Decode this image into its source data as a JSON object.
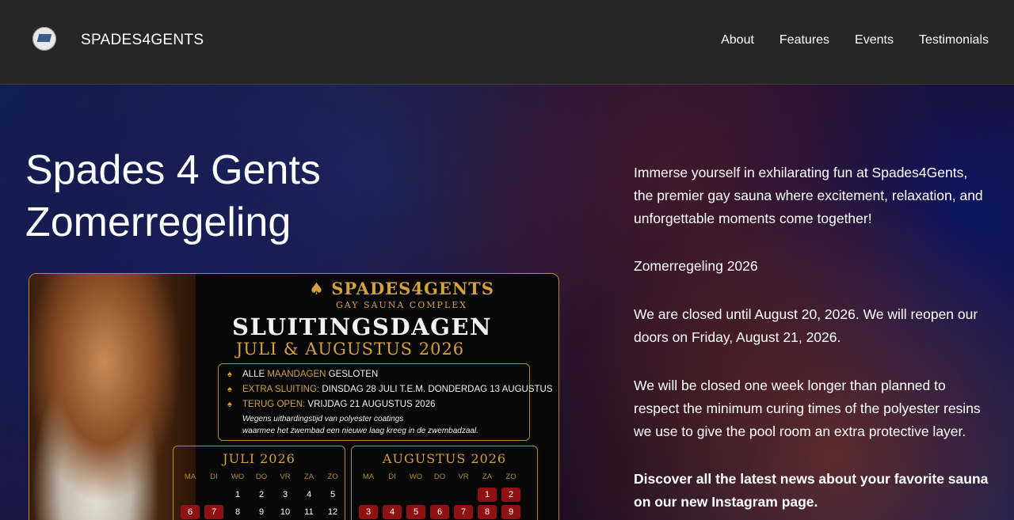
{
  "nav": {
    "brand": "SPADES4GENTS",
    "links": [
      "About",
      "Features",
      "Events",
      "Testimonials"
    ]
  },
  "hero": {
    "title_line1": "Spades 4 Gents",
    "title_line2": "Zomerregeling",
    "paragraphs": [
      "Immerse yourself in exhilarating fun at Spades4Gents, the premier gay sauna where excitement, relaxation, and unforgettable moments come together!",
      "Zomerregeling 2026",
      "We are closed until August 20, 2026. We will reopen our doors on Friday, August 21, 2026.",
      "We will be closed one week longer than planned to respect the minimum curing times of the polyester resins we use to give the pool room an extra protective layer.",
      "Discover all the latest news about your favorite sauna on our new Instagram page."
    ]
  },
  "poster": {
    "brand": "SPADES4GENTS",
    "brand_sub": "GAY SAUNA COMPLEX",
    "heading": "SLUITINGSDAGEN",
    "subheading": "JULI & AUGUSTUS 2026",
    "info": {
      "line1_a": "ALLE ",
      "line1_gold": "MAANDAGEN",
      "line1_b": " GESLOTEN",
      "line2_gold": "EXTRA SLUITING:",
      "line2_b": " DINSDAG 28 JULI T.E.M. DONDERDAG 13 AUGUSTUS",
      "line3_gold": "TERUG OPEN:",
      "line3_b": " VRIJDAG 21 AUGUSTUS 2026",
      "note1": "Wegens uithardingstijd van polyester coatings",
      "note2": "waarmee het zwembad een nieuwe laag kreeg in de zwembadzaal."
    },
    "calendar_july": {
      "title": "JULI 2026",
      "days": [
        "MA",
        "DI",
        "WO",
        "DO",
        "VR",
        "ZA",
        "ZO"
      ],
      "cells": [
        "",
        "",
        "1",
        "2",
        "3",
        "4",
        "5",
        "6",
        "7",
        "8",
        "9",
        "10",
        "11",
        "12"
      ],
      "closed": [
        "6",
        "7"
      ]
    },
    "calendar_august": {
      "title": "AUGUSTUS 2026",
      "days": [
        "MA",
        "DI",
        "WO",
        "DO",
        "VR",
        "ZA",
        "ZO"
      ],
      "cells": [
        "",
        "",
        "",
        "",
        "",
        "1",
        "2",
        "3",
        "4",
        "5",
        "6",
        "7",
        "8",
        "9"
      ],
      "closed": [
        "1",
        "2",
        "3",
        "4",
        "5",
        "6",
        "7",
        "8",
        "9"
      ]
    }
  }
}
